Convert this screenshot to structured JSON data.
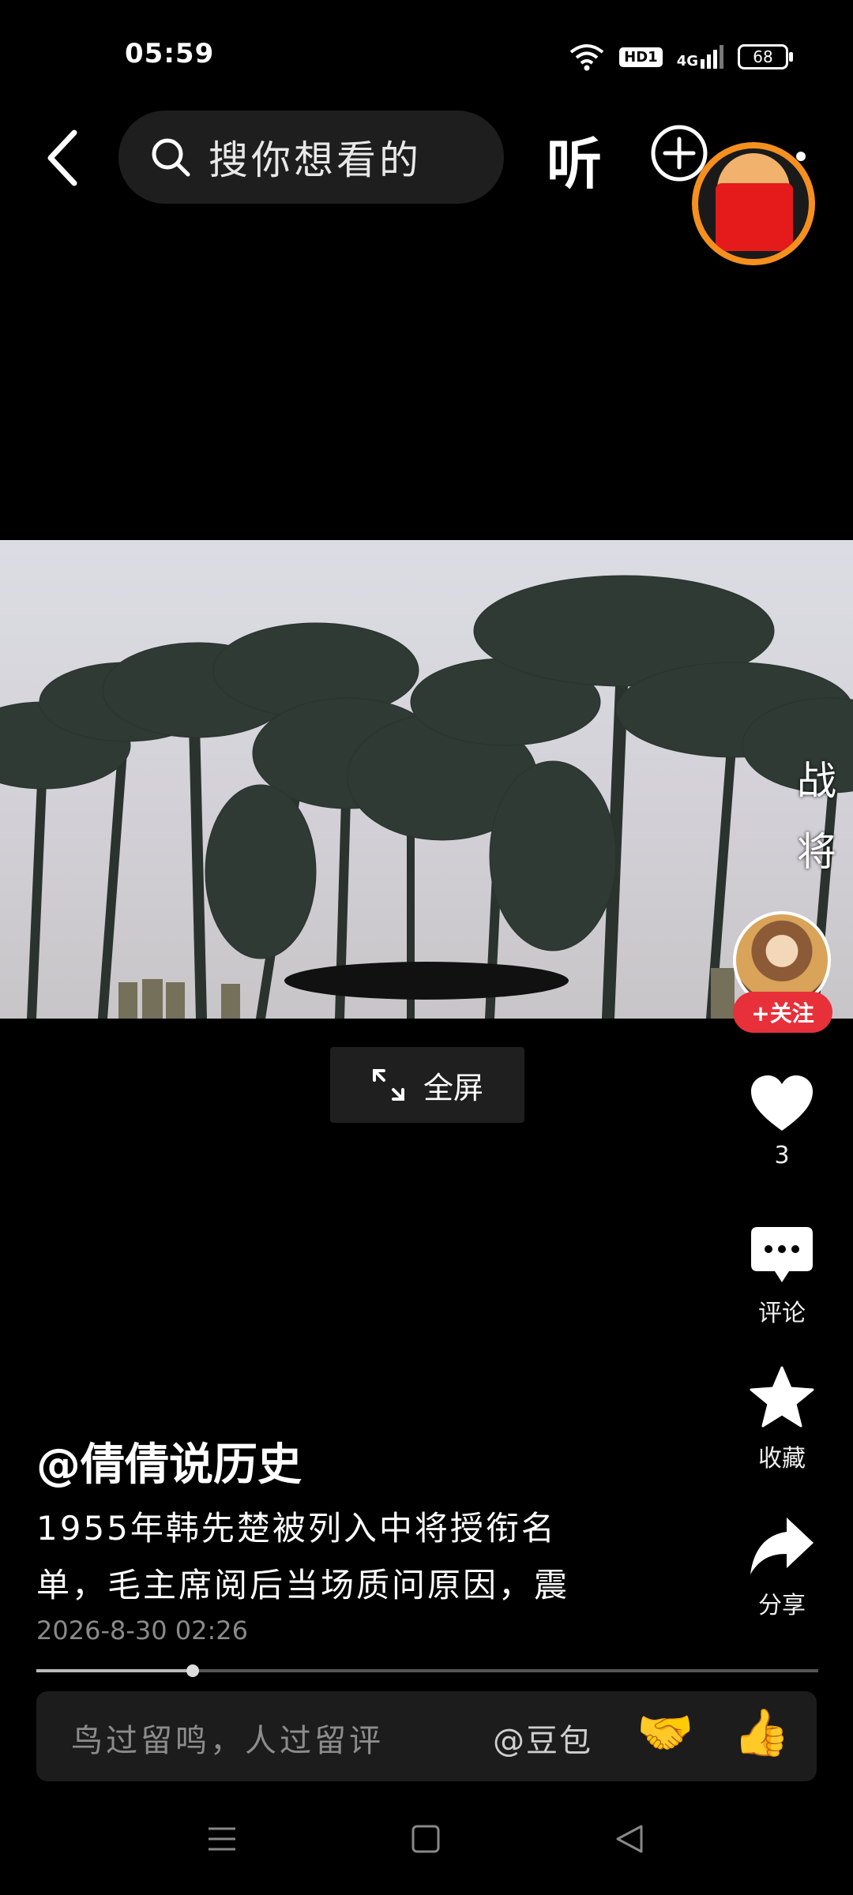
{
  "status_bar": {
    "time": "05:59",
    "hd_badge": "HD1",
    "network": "4G",
    "battery": "68"
  },
  "header": {
    "search_placeholder": "搜你想看的",
    "listen_label": "听"
  },
  "video": {
    "overlay_text_1": "战",
    "overlay_text_2": "将"
  },
  "author_panel": {
    "follow_label": "+关注"
  },
  "fullscreen": {
    "label": "全屏"
  },
  "actions": {
    "like_count": "3",
    "comment_label": "评论",
    "favorite_label": "收藏",
    "share_label": "分享"
  },
  "caption": {
    "author": "@倩倩说历史",
    "line1": "1955年韩先楚被列入中将授衔名",
    "line2": "单，毛主席阅后当场质问原因，震",
    "date": "2026-8-30 02:26",
    "progress": 0.2
  },
  "comment_bar": {
    "placeholder": "鸟过留鸣，人过留评",
    "mention": "@豆包",
    "emoji_1": "🤝",
    "emoji_2": "👍"
  },
  "icons": {
    "back": "chevron-left-icon",
    "search": "search-icon",
    "add": "plus-circle-icon",
    "more": "more-icon",
    "fullscreen": "expand-icon",
    "like": "heart-icon",
    "comment": "comment-bubble-icon",
    "favorite": "star-icon",
    "share": "share-arrow-icon",
    "nav_menu": "menu-icon",
    "nav_home": "square-icon",
    "nav_back": "triangle-back-icon"
  }
}
